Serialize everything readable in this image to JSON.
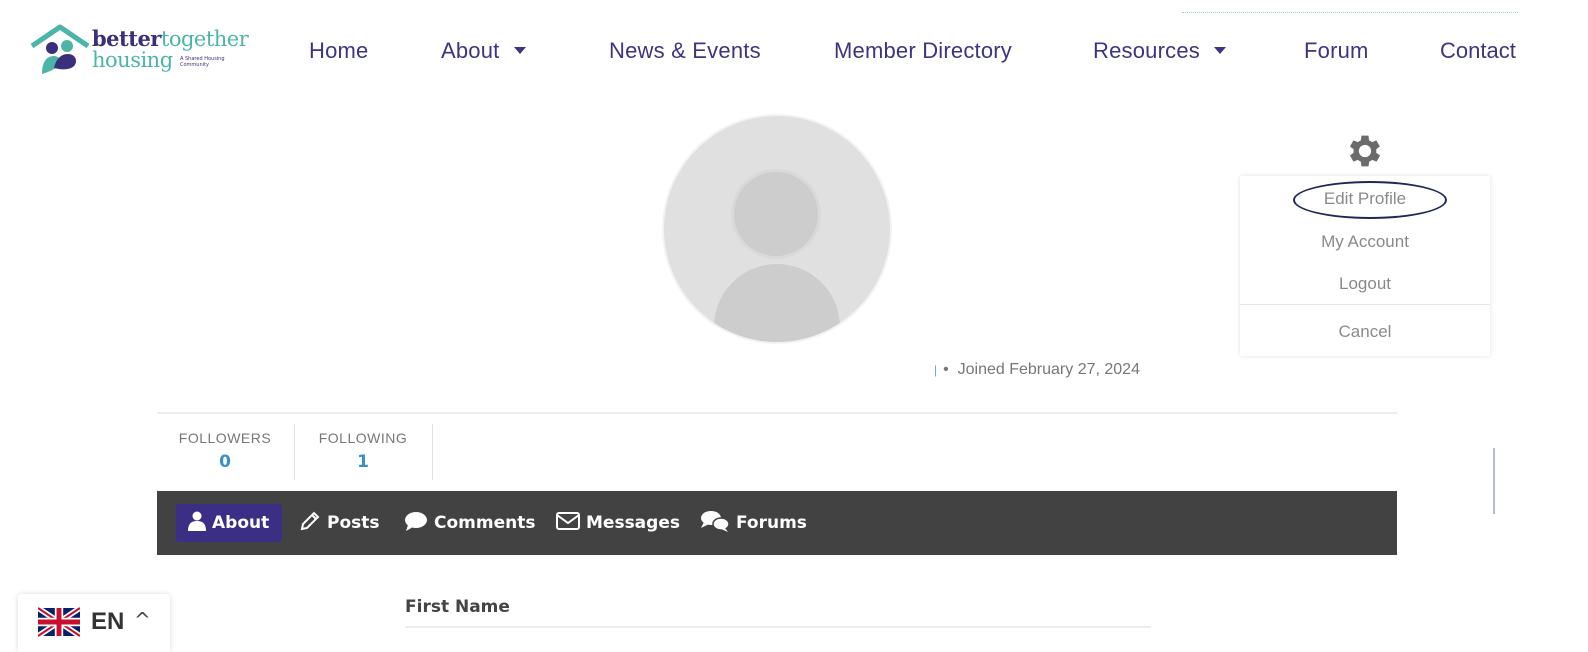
{
  "brand": {
    "name_part1": "better",
    "name_part2": "together",
    "name_line2": "housing",
    "tagline": "A Shared Housing Community"
  },
  "nav": {
    "items": [
      {
        "label": "Home",
        "has_dropdown": false
      },
      {
        "label": "About",
        "has_dropdown": true
      },
      {
        "label": "News & Events",
        "has_dropdown": false
      },
      {
        "label": "Member Directory",
        "has_dropdown": false
      },
      {
        "label": "Resources",
        "has_dropdown": true
      },
      {
        "label": "Forum",
        "has_dropdown": false
      }
    ],
    "clipped_item": "Contact"
  },
  "profile": {
    "joined_text": "Joined February 27, 2024",
    "separator": "•"
  },
  "settings_menu": {
    "icon": "gear-icon",
    "items": [
      "Edit Profile",
      "My Account",
      "Logout"
    ],
    "cancel": "Cancel",
    "highlighted_item": "Edit Profile"
  },
  "stats": {
    "followers_label": "FOLLOWERS",
    "followers_value": "0",
    "following_label": "FOLLOWING",
    "following_value": "1"
  },
  "tabs": [
    {
      "label": "About",
      "icon": "user-icon",
      "active": true
    },
    {
      "label": "Posts",
      "icon": "pencil-icon",
      "active": false
    },
    {
      "label": "Comments",
      "icon": "comment-icon",
      "active": false
    },
    {
      "label": "Messages",
      "icon": "envelope-icon",
      "active": false
    },
    {
      "label": "Forums",
      "icon": "forums-icon",
      "active": false
    }
  ],
  "about": {
    "first_name_label": "First Name"
  },
  "language": {
    "code": "EN",
    "flag": "uk-flag-icon"
  },
  "colors": {
    "brand_purple": "#3d3580",
    "brand_teal": "#4cb5a8",
    "tab_bar": "#424242",
    "tab_active": "#3b2e85",
    "stat_value": "#3b8fc9"
  }
}
